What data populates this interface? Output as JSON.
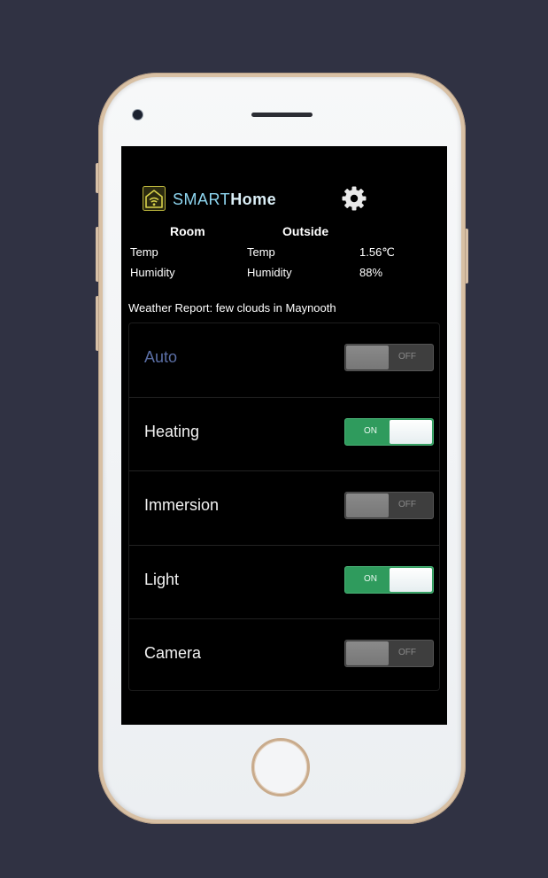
{
  "app": {
    "brand_light": "SMART",
    "brand_bold": "Home",
    "brand_icon": "smart-home-wifi-icon",
    "settings_icon": "gear-icon",
    "accent_color": "#8ed6f0",
    "on_color": "#2f9b5d"
  },
  "sensors": {
    "room": {
      "heading": "Room",
      "temp_label": "Temp",
      "humidity_label": "Humidity",
      "temp_value": "",
      "humidity_value": ""
    },
    "outside": {
      "heading": "Outside",
      "temp_label": "Temp",
      "humidity_label": "Humidity",
      "temp_value": "1.56℃",
      "humidity_value": "88%"
    }
  },
  "weather": {
    "text": "Weather Report: few clouds in Maynooth"
  },
  "controls": [
    {
      "label": "Auto",
      "on": false,
      "state_text": "OFF"
    },
    {
      "label": "Heating",
      "on": true,
      "state_text": "ON"
    },
    {
      "label": "Immersion",
      "on": false,
      "state_text": "OFF"
    },
    {
      "label": "Light",
      "on": true,
      "state_text": "ON"
    },
    {
      "label": "Camera",
      "on": false,
      "state_text": "OFF"
    }
  ]
}
